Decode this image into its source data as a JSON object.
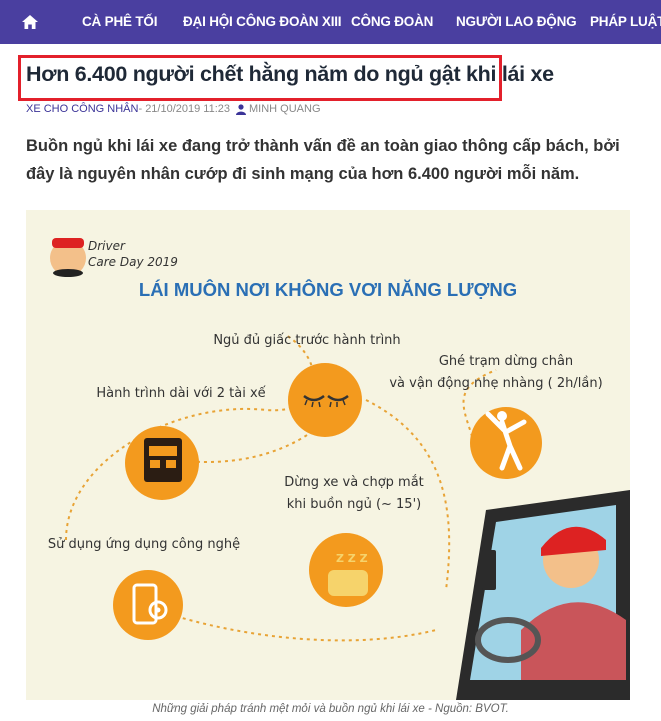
{
  "nav": {
    "home_icon": "home-icon",
    "items": [
      "CÀ PHÊ TỐI",
      "ĐẠI HỘI CÔNG ĐOÀN XIII",
      "CÔNG ĐOÀN",
      "NGƯỜI LAO ĐỘNG",
      "PHÁP LUẬT L"
    ],
    "background": "#4a3fa0"
  },
  "article": {
    "title": "Hơn 6.400 người chết hằng năm do ngủ gật khi lái xe",
    "category": "XE CHO CÔNG NHÂN",
    "date": " - 21/10/2019 11:23",
    "author_icon": "user-icon",
    "author": "MINH QUANG",
    "lead": "Buồn ngủ khi lái xe đang trở thành vấn đề an toàn giao thông cấp bách, bởi đây là nguyên nhân cướp đi sinh mạng của hơn 6.400 người mỗi năm.",
    "highlight_color": "#e3202b"
  },
  "infographic": {
    "logo_line1": "Driver",
    "logo_line2": "Care Day 2019",
    "heading": "LÁI MUÔN NƠI KHÔNG VƠI NĂNG LƯỢNG",
    "tips": [
      {
        "text": "Ngủ đủ giấc trước hành trình",
        "icon": "sleeping-eyes-icon"
      },
      {
        "text_line1": "Ghé trạm dừng chân",
        "text_line2": "và vận động nhẹ nhàng ( 2h/lần)",
        "icon": "stretching-person-icon"
      },
      {
        "text": "Hành trình dài với 2 tài xế",
        "icon": "truck-icon"
      },
      {
        "text_line1": "Dừng xe và chợp mắt",
        "text_line2": "khi buồn ngủ (~ 15')",
        "icon": "pillow-zzz-icon"
      },
      {
        "text": "Sử dụng ứng dụng công nghệ",
        "icon": "phone-settings-icon"
      }
    ],
    "accent": "#f39a1e",
    "heading_color": "#2a6fb5"
  },
  "caption": "Những giải pháp tránh mệt mỏi và buồn ngủ khi lái xe - Nguồn: BVOT."
}
